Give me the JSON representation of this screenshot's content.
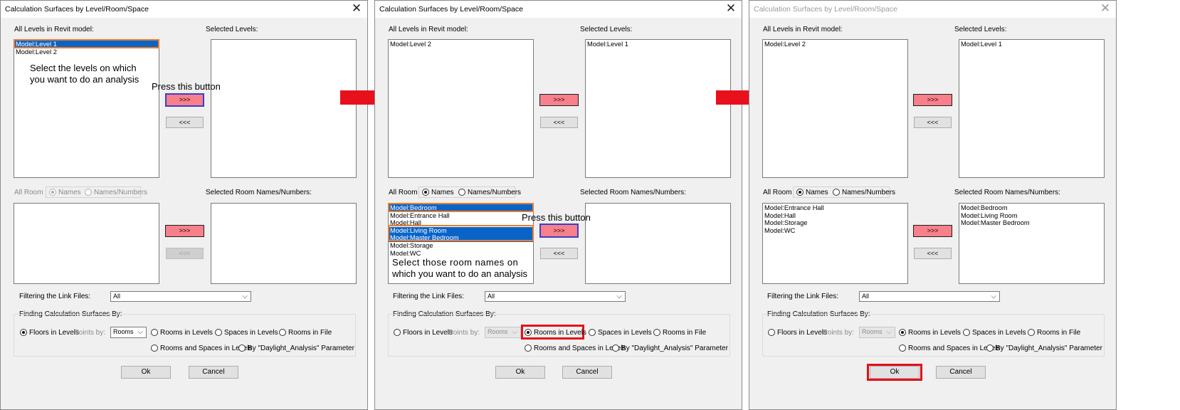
{
  "dialog": {
    "title": "Calculation Surfaces by Level/Room/Space",
    "all_levels_label": "All Levels in Revit model:",
    "selected_levels_label": "Selected Levels:",
    "all_room_label": "All Room",
    "names_label": "Names",
    "names_numbers_label": "Names/Numbers",
    "selected_rooms_label": "Selected Room Names/Numbers:",
    "add_label": ">>>",
    "remove_label": "<<<",
    "filter_label": "Filtering the Link Files:",
    "filter_value": "All",
    "finding_label": "Finding Calculation Surfaces By:",
    "floors_label": "Floors in Levels",
    "points_by_label": "- Points by:",
    "points_value": "Rooms",
    "rooms_in_levels": "Rooms in Levels",
    "spaces_in_levels": "Spaces in Levels",
    "rooms_in_file": "Rooms in File",
    "rooms_and_spaces": "Rooms and Spaces in Levels",
    "by_parameter": "By \"Daylight_Analysis\" Parameter",
    "ok_label": "Ok",
    "cancel_label": "Cancel"
  },
  "panel1": {
    "levels": [
      "Model:Level 1",
      "Model:Level 2"
    ],
    "note_select_levels_1": "Select the levels on which",
    "note_select_levels_2": "you want to do an analysis",
    "note_press": "Press this button"
  },
  "panel2": {
    "levels": [
      "Model:Level 2"
    ],
    "selected_levels": [
      "Model:Level 1"
    ],
    "rooms": [
      "Model:Bedroom",
      "Model:Entrance Hall",
      "Model:Hall",
      "Model:Living Room",
      "Model:Master Bedroom",
      "Model:Storage",
      "Model:WC"
    ],
    "note_press": "Press this button",
    "note_select_rooms_1": "Select those room names on",
    "note_select_rooms_2": "which you want to do an analysis"
  },
  "panel3": {
    "levels": [
      "Model:Level 2"
    ],
    "selected_levels": [
      "Model:Level 1"
    ],
    "rooms": [
      "Model:Entrance Hall",
      "Model:Hall",
      "Model:Storage",
      "Model:WC"
    ],
    "selected_rooms": [
      "Model:Bedroom",
      "Model:Living Room",
      "Model:Master Bedroom"
    ]
  },
  "colors": {
    "selection": "#0a64c8",
    "highlight_button": "#f7808a",
    "annotation_red": "#e3101a",
    "annotation_orange": "#f07b25",
    "annotation_blue": "#3d3dcc"
  },
  "icons": {
    "close": "close-icon",
    "arrow": "right-arrow-icon",
    "dropdown": "chevron-down-icon"
  }
}
